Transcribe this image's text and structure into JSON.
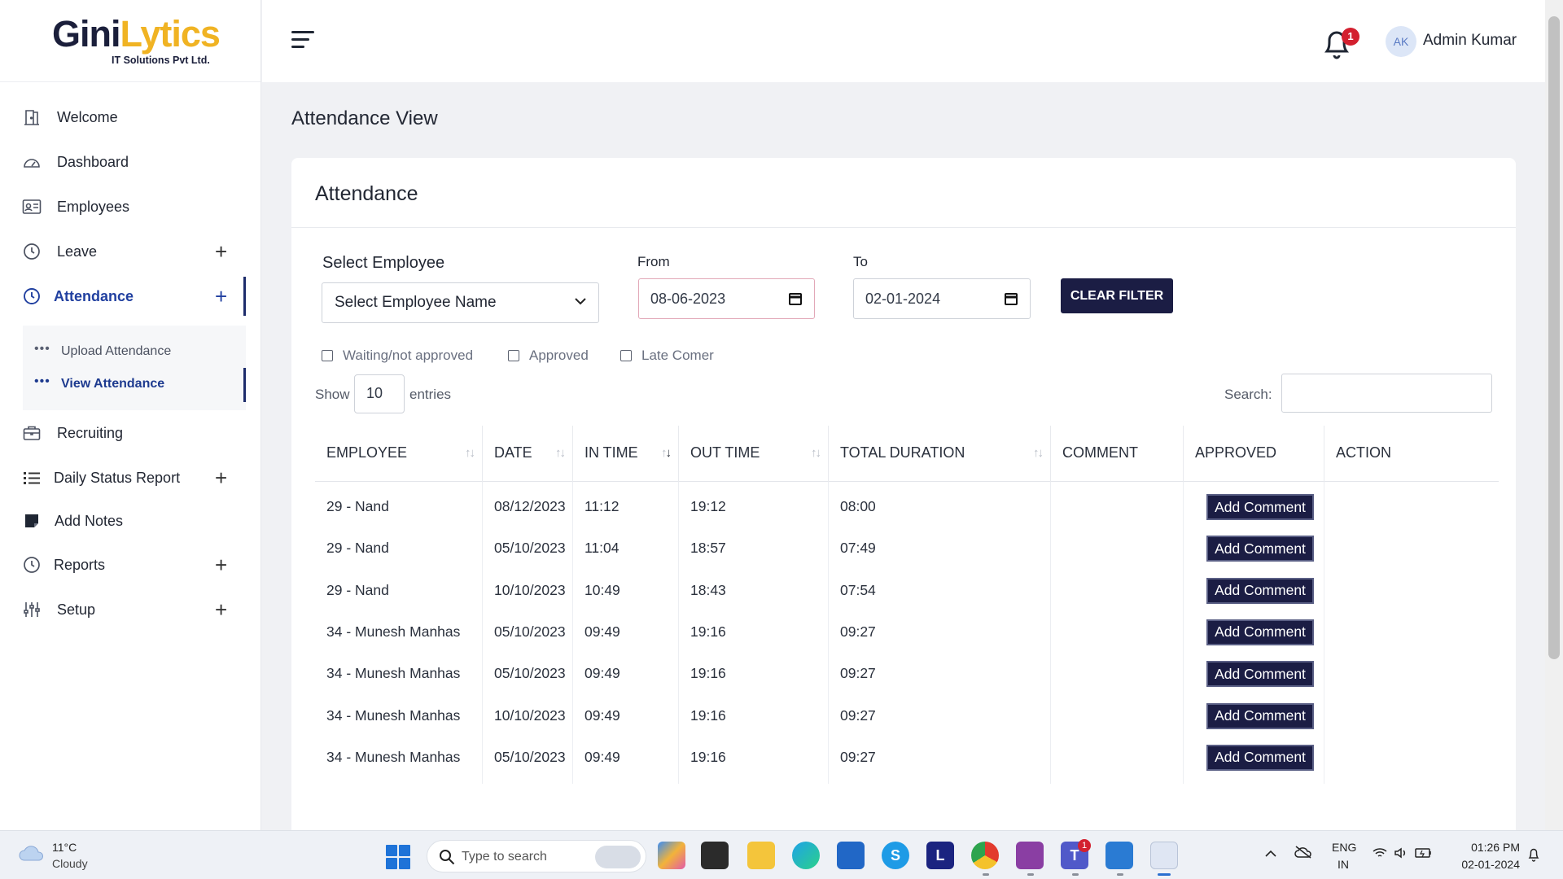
{
  "brand": {
    "name_part1": "Gini",
    "name_part2": "Lytics",
    "tagline": "IT Solutions Pvt Ltd."
  },
  "sidebar": {
    "items": [
      {
        "label": "Welcome",
        "icon": "door-icon",
        "expandable": false
      },
      {
        "label": "Dashboard",
        "icon": "gauge-icon",
        "expandable": false
      },
      {
        "label": "Employees",
        "icon": "id-card-icon",
        "expandable": false
      },
      {
        "label": "Leave",
        "icon": "clock-icon",
        "expandable": true
      },
      {
        "label": "Attendance",
        "icon": "clock-icon",
        "expandable": true,
        "active": true
      },
      {
        "label": "Recruiting",
        "icon": "briefcase-icon",
        "expandable": false
      },
      {
        "label": "Daily Status Report",
        "icon": "list-icon",
        "expandable": true
      },
      {
        "label": "Add Notes",
        "icon": "note-icon",
        "expandable": false
      },
      {
        "label": "Reports",
        "icon": "clock-icon",
        "expandable": true
      },
      {
        "label": "Setup",
        "icon": "sliders-icon",
        "expandable": true
      }
    ],
    "attendance_sub": [
      {
        "label": "Upload Attendance",
        "active": false
      },
      {
        "label": "View Attendance",
        "active": true
      }
    ],
    "plus_glyph": "+"
  },
  "header": {
    "notification_count": "1",
    "avatar_initials": "AK",
    "user_name": "Admin Kumar"
  },
  "page": {
    "title": "Attendance View",
    "card_title": "Attendance",
    "filters": {
      "select_label": "Select Employee",
      "select_value": "Select Employee Name",
      "from_label": "From",
      "from_value": "08-06-2023",
      "to_label": "To",
      "to_value": "02-01-2024",
      "clear_label": "CLEAR FILTER",
      "checkboxes": [
        "Waiting/not approved",
        "Approved",
        "Late Comer"
      ]
    },
    "show_label": "Show",
    "entries_value": "10",
    "entries_label": "entries",
    "search_label": "Search:",
    "table": {
      "columns": [
        "EMPLOYEE",
        "DATE",
        "IN TIME",
        "OUT TIME",
        "TOTAL DURATION",
        "COMMENT",
        "APPROVED",
        "ACTION"
      ],
      "rows": [
        {
          "employee": "29 - Nand",
          "date": "08/12/2023",
          "in": "11:12",
          "out": "19:12",
          "duration": "08:00",
          "comment": "",
          "approved": "",
          "action": "Add Comment"
        },
        {
          "employee": "29 - Nand",
          "date": "05/10/2023",
          "in": "11:04",
          "out": "18:57",
          "duration": "07:49",
          "comment": "",
          "approved": "",
          "action": "Add Comment"
        },
        {
          "employee": "29 - Nand",
          "date": "10/10/2023",
          "in": "10:49",
          "out": "18:43",
          "duration": "07:54",
          "comment": "",
          "approved": "",
          "action": "Add Comment"
        },
        {
          "employee": "34 - Munesh Manhas",
          "date": "05/10/2023",
          "in": "09:49",
          "out": "19:16",
          "duration": "09:27",
          "comment": "",
          "approved": "",
          "action": "Add Comment"
        },
        {
          "employee": "34 - Munesh Manhas",
          "date": "05/10/2023",
          "in": "09:49",
          "out": "19:16",
          "duration": "09:27",
          "comment": "",
          "approved": "",
          "action": "Add Comment"
        },
        {
          "employee": "34 - Munesh Manhas",
          "date": "10/10/2023",
          "in": "09:49",
          "out": "19:16",
          "duration": "09:27",
          "comment": "",
          "approved": "",
          "action": "Add Comment"
        },
        {
          "employee": "34 - Munesh Manhas",
          "date": "05/10/2023",
          "in": "09:49",
          "out": "19:16",
          "duration": "09:27",
          "comment": "",
          "approved": "",
          "action": "Add Comment"
        }
      ]
    }
  },
  "taskbar": {
    "weather_temp": "11°C",
    "weather_cond": "Cloudy",
    "search_placeholder": "Type to search",
    "lang_top": "ENG",
    "lang_bottom": "IN",
    "time": "01:26 PM",
    "date": "02-01-2024",
    "teams_badge": "1",
    "apps": [
      "copilot-icon",
      "terminal-icon",
      "file-explorer-icon",
      "edge-icon",
      "store-icon",
      "skype-icon",
      "l-app-icon",
      "chrome-icon",
      "paint-icon",
      "teams-icon",
      "vscode-icon",
      "snipping-tool-icon"
    ]
  },
  "colors": {
    "accent": "#1b1d44",
    "active_nav": "#2140a0",
    "badge": "#d3202f",
    "logo_yellow": "#f0b323"
  }
}
